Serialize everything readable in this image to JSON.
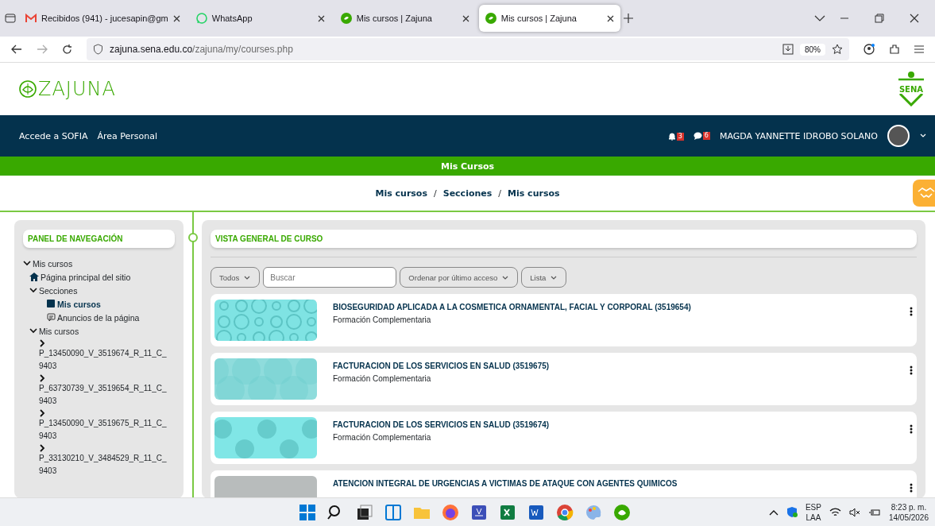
{
  "browser": {
    "tabs": [
      {
        "title": "Recibidos (941) - jucesapin@gm",
        "kind": "gmail",
        "selected": false
      },
      {
        "title": "WhatsApp",
        "kind": "whatsapp",
        "selected": false
      },
      {
        "title": "Mis cursos | Zajuna",
        "kind": "zajuna",
        "selected": false
      },
      {
        "title": "Mis cursos | Zajuna",
        "kind": "zajuna",
        "selected": true
      }
    ],
    "url_host": "zajuna.sena.edu.co",
    "url_path": "/zajuna/my/courses.php",
    "zoom": "80%"
  },
  "header": {
    "logo": "ZAJUNA",
    "sena": "SENA"
  },
  "navbar": {
    "links": [
      "Accede a SOFIA",
      "Área Personal"
    ],
    "notifications": "3",
    "messages": "6",
    "user": "MAGDA YANNETTE IDROBO SOLANO"
  },
  "page_title": "Mis Cursos",
  "breadcrumb": [
    {
      "kind": "link",
      "text": "Mis cursos"
    },
    {
      "kind": "separator",
      "text": "/"
    },
    {
      "kind": "link",
      "text": "Secciones"
    },
    {
      "kind": "separator",
      "text": "/"
    },
    {
      "kind": "link",
      "text": "Mis cursos"
    }
  ],
  "nav_panel": {
    "title": "PANEL DE NAVEGACIÓN",
    "tree": [
      {
        "label": "Mis cursos",
        "kind": "folder",
        "expanded": true,
        "children": [
          {
            "label": "Página principal del sitio",
            "kind": "home"
          },
          {
            "label": "Secciones",
            "kind": "folder",
            "expanded": true,
            "children": [
              {
                "label": "Mis cursos",
                "kind": "page",
                "selected": true
              },
              {
                "label": "Anuncios de la página",
                "kind": "forum",
                "selected": false
              }
            ]
          },
          {
            "label": "Mis cursos",
            "kind": "folder",
            "expanded": true,
            "children": [
              {
                "label": "P_13450090_V_3519674_R_11_C_9403",
                "kind": "course",
                "expanded": false
              },
              {
                "label": "P_63730739_V_3519654_R_11_C_9403",
                "kind": "course",
                "expanded": false
              },
              {
                "label": "P_13450090_V_3519675_R_11_C_9403",
                "kind": "course",
                "expanded": false
              },
              {
                "label": "P_33130210_V_3484529_R_11_C_9403",
                "kind": "course",
                "expanded": false
              }
            ]
          }
        ]
      }
    ]
  },
  "overview": {
    "title": "VISTA GENERAL DE CURSO",
    "filter": "Todos",
    "search": {
      "placeholder": "Buscar"
    },
    "sort": "Ordenar por último acceso",
    "view": "Lista",
    "courses": [
      {
        "name": "BIOSEGURIDAD APLICADA A LA COSMETICA ORNAMENTAL, FACIAL Y CORPORAL (3519654)",
        "category": "Formación Complementaria",
        "kind": "rings"
      },
      {
        "name": "FACTURACION DE LOS SERVICIOS EN SALUD (3519675)",
        "category": "Formación Complementaria",
        "kind": "circles"
      },
      {
        "name": "FACTURACION DE LOS SERVICIOS EN SALUD (3519674)",
        "category": "Formación Complementaria",
        "kind": "octagons"
      },
      {
        "name": "ATENCION INTEGRAL DE URGENCIAS A VICTIMAS DE ATAQUE CON AGENTES QUIMICOS",
        "kind": "grey"
      }
    ]
  },
  "taskbar": {
    "lang": "ESP",
    "layout": "LAA",
    "time": "8:23 p. m.",
    "date": "14/05/2026"
  }
}
